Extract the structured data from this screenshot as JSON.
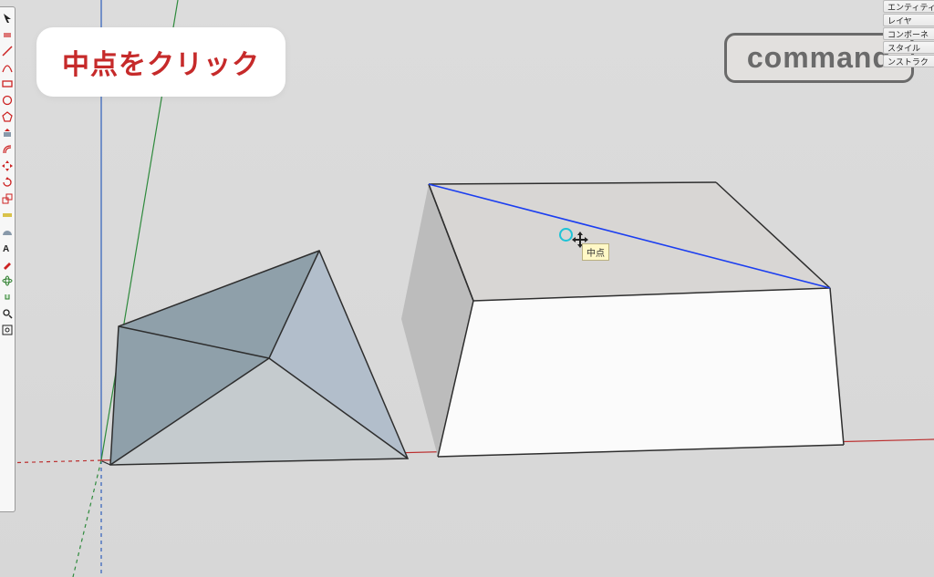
{
  "callout_text": "中点をクリック",
  "keycap_label": "command",
  "tooltip_text": "中点",
  "tray_tabs": [
    "エンティティ",
    "レイヤ",
    "コンポーネ",
    "スタイル",
    "ンストラク"
  ],
  "tools": [
    "select-tool",
    "eraser-tool",
    "line-tool",
    "arc-tool",
    "rectangle-tool",
    "circle-tool",
    "polygon-tool",
    "pushpull-tool",
    "offset-tool",
    "move-tool",
    "rotate-tool",
    "scale-tool",
    "tape-tool",
    "protractor-tool",
    "text-tool",
    "paint-tool",
    "orbit-tool",
    "pan-tool",
    "zoom-tool",
    "zoom-extents-tool"
  ]
}
